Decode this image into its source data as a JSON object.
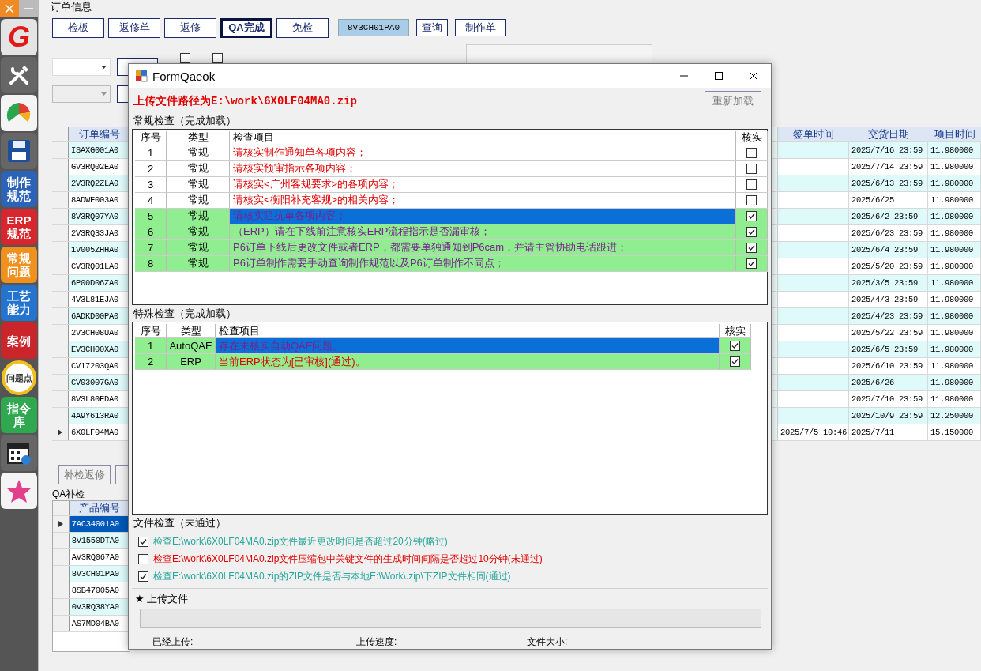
{
  "sidebar": {
    "items": [
      {
        "kind": "logo",
        "label": "G"
      },
      {
        "kind": "tools"
      },
      {
        "kind": "chart"
      },
      {
        "kind": "save"
      },
      {
        "kind": "tile",
        "label": "制作规范",
        "color": "#2a63b8"
      },
      {
        "kind": "tile",
        "label": "ERP规范",
        "color": "#d8262e"
      },
      {
        "kind": "tile",
        "label": "常规问题",
        "color": "#f0901e"
      },
      {
        "kind": "tile",
        "label": "工艺能力",
        "color": "#2373cf"
      },
      {
        "kind": "tile",
        "label": "案例",
        "color": "#c9252b"
      },
      {
        "kind": "circle",
        "label": "问题点"
      },
      {
        "kind": "tile",
        "label": "指令库",
        "color": "#2fa84f"
      },
      {
        "kind": "calendar"
      },
      {
        "kind": "star"
      }
    ]
  },
  "order_info": {
    "title": "订单信息",
    "buttons": [
      {
        "label": "检板",
        "selected": false
      },
      {
        "label": "返修单",
        "selected": false
      },
      {
        "label": "返修",
        "selected": false
      },
      {
        "label": "QA完成",
        "selected": true
      },
      {
        "label": "免检",
        "selected": false
      }
    ],
    "order_field": "8V3CH01PA0",
    "query_button": "查询",
    "make_button": "制作单",
    "filters": [
      {
        "checked": false
      },
      {
        "checked": false
      }
    ]
  },
  "orders": {
    "columns": [
      "订单编号",
      "签单时间",
      "交货日期",
      "项目时间"
    ],
    "rows": [
      {
        "order_no": "ISAXG001A0",
        "delivery_date": "2025/7/16 23:59",
        "project_time": "11.980000",
        "selected": false
      },
      {
        "order_no": "GV3RQ02EA0",
        "delivery_date": "2025/7/14 23:59",
        "project_time": "11.980000",
        "selected": false
      },
      {
        "order_no": "2V3RQ2ZLA0",
        "delivery_date": "2025/6/13 23:59",
        "project_time": "11.980000",
        "selected": false
      },
      {
        "order_no": "8ADWF003A0",
        "delivery_date": "2025/6/25",
        "project_time": "11.980000",
        "selected": false
      },
      {
        "order_no": "8V3RQ07YA0",
        "delivery_date": "2025/6/2 23:59",
        "project_time": "11.980000",
        "selected": false
      },
      {
        "order_no": "2V3RQ33JA0",
        "delivery_date": "2025/6/23 23:59",
        "project_time": "11.980000",
        "selected": false
      },
      {
        "order_no": "1V005ZHHA0",
        "delivery_date": "2025/6/4 23:59",
        "project_time": "11.980000",
        "selected": false
      },
      {
        "order_no": "CV3RQ01LA0",
        "delivery_date": "2025/5/20 23:59",
        "project_time": "11.980000",
        "selected": false
      },
      {
        "order_no": "6P00D06ZA0",
        "delivery_date": "2025/3/5 23:59",
        "project_time": "11.980000",
        "selected": false
      },
      {
        "order_no": "4V3L81EJA0",
        "delivery_date": "2025/4/3 23:59",
        "project_time": "11.980000",
        "selected": false
      },
      {
        "order_no": "6ADKD00PA0",
        "delivery_date": "2025/4/23 23:59",
        "project_time": "11.980000",
        "selected": false
      },
      {
        "order_no": "2V3CH08UA0",
        "delivery_date": "2025/5/22 23:59",
        "project_time": "11.980000",
        "selected": false
      },
      {
        "order_no": "EV3CH00XA0",
        "delivery_date": "2025/6/5 23:59",
        "project_time": "11.980000",
        "selected": false
      },
      {
        "order_no": "CV17203QA0",
        "delivery_date": "2025/6/10 23:59",
        "project_time": "11.980000",
        "selected": false
      },
      {
        "order_no": "CV03007GA0",
        "delivery_date": "2025/6/26",
        "project_time": "11.980000",
        "selected": false
      },
      {
        "order_no": "8V3L80FDA0",
        "delivery_date": "2025/7/10 23:59",
        "project_time": "11.980000",
        "selected": false
      },
      {
        "order_no": "4A9Y613RA0",
        "delivery_date": "2025/10/9 23:59",
        "project_time": "12.250000",
        "selected": false
      },
      {
        "order_no": "6X0LF04MA0",
        "sign_time": "2025/7/5 10:46",
        "delivery_date": "2025/7/11",
        "project_time": "15.150000",
        "selected": true
      }
    ]
  },
  "qa_recheck": {
    "button": "补检返修",
    "title": "QA补检",
    "columns": [
      "产品编号"
    ],
    "rows": [
      {
        "product_no": "7AC34001A0",
        "selected": true
      },
      {
        "product_no": "8V1550DTA0",
        "selected": false
      },
      {
        "product_no": "AV3RQ067A0",
        "selected": false
      },
      {
        "product_no": "8V3CH01PA0",
        "selected": false
      },
      {
        "product_no": "8SB47005A0",
        "selected": false
      },
      {
        "product_no": "0V3RQ38YA0",
        "selected": false
      },
      {
        "product_no": "AS7MD04BA0",
        "selected": false
      }
    ]
  },
  "dialog": {
    "title": "FormQaeok",
    "upload_path": "上传文件路径为E:\\work\\6X0LF04MA0.zip",
    "reload_button": "重新加载",
    "regular": {
      "title": "常规检查（完成加载）",
      "columns": [
        "序号",
        "类型",
        "检查项目",
        "核实"
      ],
      "rows": [
        {
          "no": "1",
          "type": "常规",
          "item": "请核实制作通知单各项内容；",
          "kind": "alert",
          "checked": false,
          "selected": false
        },
        {
          "no": "2",
          "type": "常规",
          "item": "请核实预审指示各项内容；",
          "kind": "alert",
          "checked": false,
          "selected": false
        },
        {
          "no": "3",
          "type": "常规",
          "item": "请核实<广州客规要求>的各项内容；",
          "kind": "alert",
          "checked": false,
          "selected": false
        },
        {
          "no": "4",
          "type": "常规",
          "item": "请核实<衡阳补充客规>的相关内容；",
          "kind": "alert",
          "checked": false,
          "selected": false
        },
        {
          "no": "5",
          "type": "常规",
          "item": "请核实阻抗单各项内容；",
          "kind": "note",
          "checked": true,
          "selected": true
        },
        {
          "no": "6",
          "type": "常规",
          "item": "（ERP）请在下线前注意核实ERP流程指示是否漏审核；",
          "kind": "note",
          "checked": true,
          "selected": false
        },
        {
          "no": "7",
          "type": "常规",
          "item": "P6订单下线后更改文件或者ERP，都需要单独通知到P6cam，并请主管协助电话跟进；",
          "kind": "note",
          "checked": true,
          "selected": false
        },
        {
          "no": "8",
          "type": "常规",
          "item": "P6订单制作需要手动查询制作规范以及P6订单制作不同点；",
          "kind": "note",
          "checked": true,
          "selected": false
        }
      ]
    },
    "special": {
      "title": "特殊检查（完成加载）",
      "columns": [
        "序号",
        "类型",
        "检查项目",
        "核实"
      ],
      "rows": [
        {
          "no": "1",
          "type": "AutoQAE",
          "item": "存在未核实自动QAE问题。",
          "kind": "note",
          "checked": true,
          "selected": true
        },
        {
          "no": "2",
          "type": "ERP",
          "item": "当前ERP状态为[已审核](通过)。",
          "kind": "alert",
          "checked": true,
          "selected": false
        }
      ]
    },
    "file_check": {
      "title": "文件检查（未通过）",
      "items": [
        {
          "text": "检查E:\\work\\6X0LF04MA0.zip文件最近更改时间是否超过20分钟(略过)",
          "checked": true,
          "color": "#26a69a"
        },
        {
          "text": "检查E:\\work\\6X0LF04MA0.zip文件压缩包中关键文件的生成时间间隔是否超过10分钟(未通过)",
          "checked": false,
          "color": "#e00000"
        },
        {
          "text": "检查E:\\work\\6X0LF04MA0.zip的ZIP文件是否与本地E:\\Work\\.zip\\下ZIP文件相同(通过)",
          "checked": true,
          "color": "#26a69a"
        }
      ]
    },
    "upload": {
      "title": "★ 上传文件",
      "level": 0,
      "uploaded_label": "已经上传:",
      "speed_label": "上传速度:",
      "size_label": "文件大小:"
    }
  }
}
